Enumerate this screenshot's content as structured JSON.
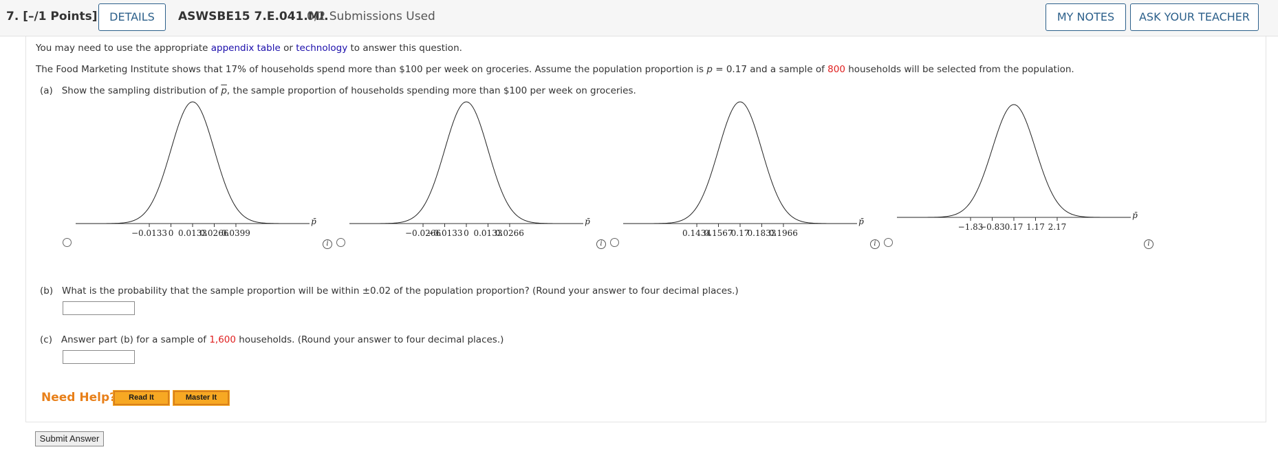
{
  "header": {
    "question_number": "7. [–/1 Points]",
    "details_button": "DETAILS",
    "assignment_id": "ASWSBE15 7.E.041.MI.",
    "submissions": "0/2 Submissions Used",
    "my_notes_button": "MY NOTES",
    "ask_teacher_button": "ASK YOUR TEACHER"
  },
  "intro": {
    "pre": "You may need to use the appropriate ",
    "link1": "appendix table",
    "mid": " or ",
    "link2": "technology",
    "post": " to answer this question."
  },
  "problem": {
    "text1": "The Food Marketing Institute shows that 17% of households spend more than $100 per week on groceries. Assume the population proportion is ",
    "p_symbol": "p",
    "text2": " = 0.17 and a sample of ",
    "sample_size": "800",
    "text3": " households will be selected from the population."
  },
  "part_a": {
    "label": "(a)",
    "text1": "Show the sampling distribution of ",
    "pbar": "p",
    "text2": ", the sample proportion of households spending more than $100 per week on groceries."
  },
  "chart_data": [
    {
      "type": "line",
      "axis_label": "p̄",
      "ticks": [
        "−0.0133",
        "0",
        "0.0133",
        "0.0266",
        "0.0399"
      ],
      "tick_values": [
        -0.0133,
        0,
        0.0133,
        0.0266,
        0.0399
      ],
      "mean": 0.0133,
      "sd": 0.0133
    },
    {
      "type": "line",
      "axis_label": "p̄",
      "ticks": [
        "−0.0266",
        "−0.0133",
        "0",
        "0.0133",
        "0.0266"
      ],
      "tick_values": [
        -0.0266,
        -0.0133,
        0,
        0.0133,
        0.0266
      ],
      "mean": 0,
      "sd": 0.0133
    },
    {
      "type": "line",
      "axis_label": "p̄",
      "ticks": [
        "0.1434",
        "0.1567",
        "0.17",
        "0.1833",
        "0.1966"
      ],
      "tick_values": [
        0.1434,
        0.1567,
        0.17,
        0.1833,
        0.1966
      ],
      "mean": 0.17,
      "sd": 0.0133
    },
    {
      "type": "line",
      "axis_label": "p̄",
      "ticks": [
        "−1.83",
        "−0.83",
        "0.17",
        "1.17",
        "2.17"
      ],
      "tick_values": [
        -1.83,
        -0.83,
        0.17,
        1.17,
        2.17
      ],
      "mean": 0.17,
      "sd": 1
    }
  ],
  "info_glyph": "i",
  "part_b": {
    "label": "(b)",
    "text": "What is the probability that the sample proportion will be within ±0.02 of the population proportion? (Round your answer to four decimal places.)",
    "value": ""
  },
  "part_c": {
    "label": "(c)",
    "text1": "Answer part (b) for a sample of ",
    "sample_size": "1,600",
    "text2": " households. (Round your answer to four decimal places.)",
    "value": ""
  },
  "help": {
    "label": "Need Help?",
    "read_it": "Read It",
    "master_it": "Master It"
  },
  "submit_button": "Submit Answer",
  "colors": {
    "accent": "#2b5f8a",
    "link": "#1a0dab",
    "highlight": "#e02020",
    "help_orange": "#e8801a",
    "help_button": "#f7a823"
  }
}
